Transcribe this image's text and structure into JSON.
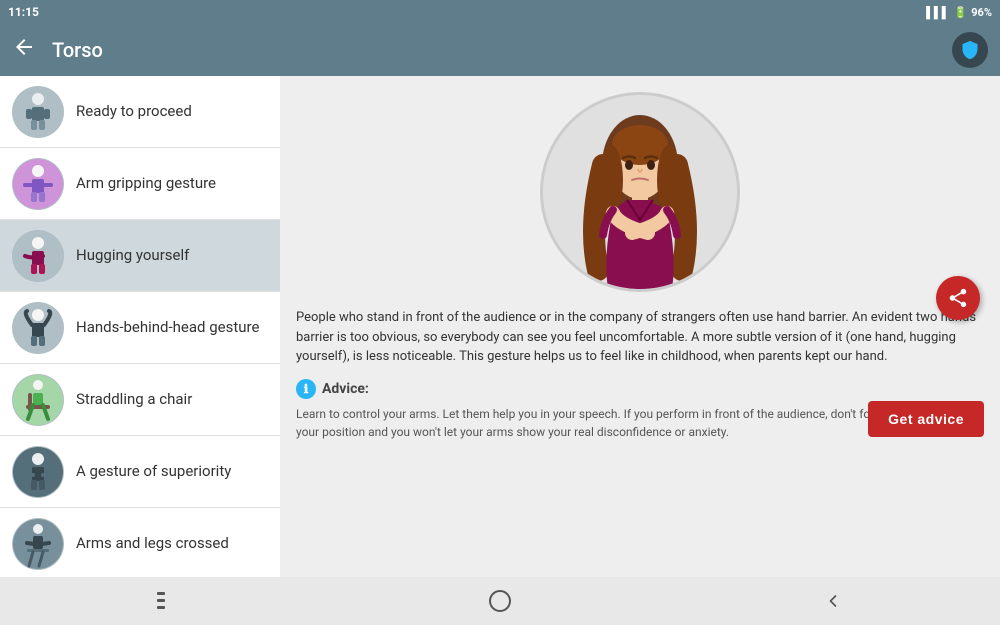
{
  "statusBar": {
    "time": "11:15",
    "battery": "96%",
    "signal": "▌▌▌"
  },
  "toolbar": {
    "title": "Torso",
    "backLabel": "←",
    "iconName": "diamond-icon"
  },
  "sidebar": {
    "items": [
      {
        "id": "ready-to-proceed",
        "label": "Ready to proceed",
        "active": false,
        "avatarColor": "#78909c"
      },
      {
        "id": "arm-gripping",
        "label": "Arm gripping gesture",
        "active": false,
        "avatarColor": "#7e57c2"
      },
      {
        "id": "hugging-yourself",
        "label": "Hugging yourself",
        "active": true,
        "avatarColor": "#78909c"
      },
      {
        "id": "hands-behind-head",
        "label": "Hands-behind-head gesture",
        "active": false,
        "avatarColor": "#78909c"
      },
      {
        "id": "straddling-chair",
        "label": "Straddling a chair",
        "active": false,
        "avatarColor": "#78909c"
      },
      {
        "id": "gesture-superiority",
        "label": "A gesture of superiority",
        "active": false,
        "avatarColor": "#546e7a"
      },
      {
        "id": "arms-legs-crossed",
        "label": "Arms and legs crossed",
        "active": false,
        "avatarColor": "#546e7a"
      }
    ]
  },
  "detail": {
    "description": "People who stand in front of the audience or in the company of strangers often use hand barrier. An evident two hands barrier is too obvious, so everybody can see you feel uncomfortable. A more subtle version of it (one hand, hugging yourself), is less noticeable. This gesture helps us to feel like in childhood, when parents kept our hand.",
    "adviceLabel": "Advice:",
    "adviceText": "Learn to control your arms. Let them help you in your speech. If you perform in front of the audience, don't forget to move, change your position and you won't let your arms show your real disconfidence or anxiety.",
    "getAdviceBtn": "Get advice",
    "shareIconName": "share-icon"
  },
  "bottomNav": {
    "menuIcon": "|||",
    "homeIcon": "○",
    "backIcon": "<"
  }
}
